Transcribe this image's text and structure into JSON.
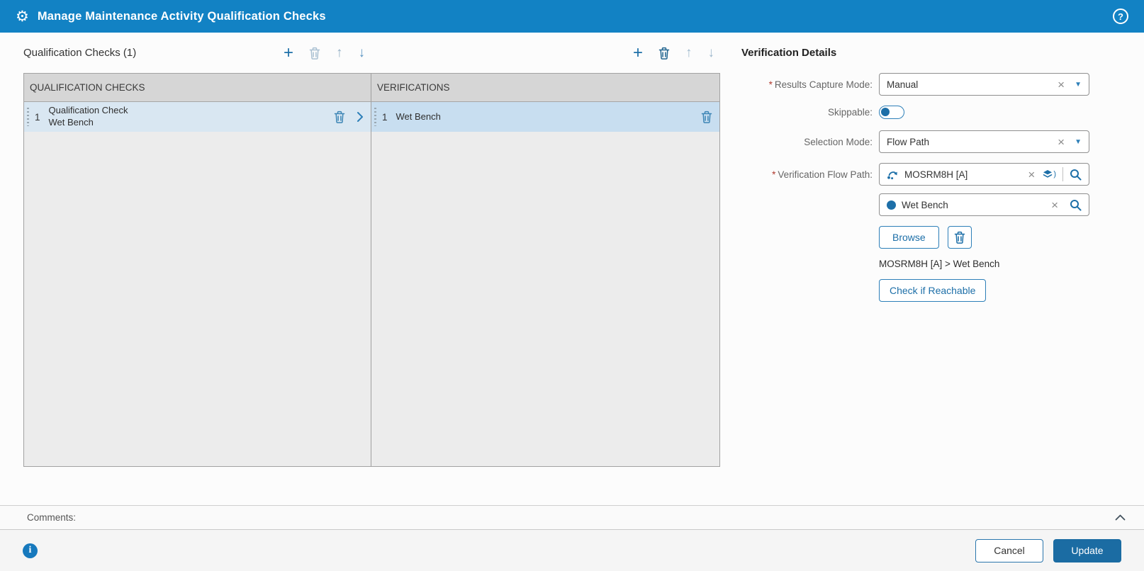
{
  "header": {
    "title": "Manage Maintenance Activity Qualification Checks"
  },
  "icons": {
    "add": "+",
    "move_up": "↑",
    "move_down": "↓",
    "clear": "×",
    "caret_down": "▼",
    "help": "?",
    "info": "i",
    "gear": "⚙"
  },
  "qualification_section": {
    "title": "Qualification Checks (1)"
  },
  "table": {
    "columns": [
      {
        "header": "QUALIFICATION CHECKS"
      },
      {
        "header": "VERIFICATIONS"
      }
    ],
    "qualification_rows": [
      {
        "index": "1",
        "title": "Qualification Check",
        "subtitle": "Wet Bench"
      }
    ],
    "verification_rows": [
      {
        "index": "1",
        "label": "Wet Bench"
      }
    ]
  },
  "details_panel": {
    "title": "Verification Details",
    "required_marker": "*",
    "results_capture_mode": {
      "label": "Results Capture Mode:",
      "value": "Manual"
    },
    "skippable": {
      "label": "Skippable:",
      "state": "off"
    },
    "selection_mode": {
      "label": "Selection Mode:",
      "value": "Flow Path"
    },
    "verification_flow_path": {
      "label": "Verification Flow Path:",
      "value": "MOSRM8H [A]",
      "sub_value": "Wet Bench"
    },
    "browse_button": "Browse",
    "path_text": "MOSRM8H [A] > Wet Bench",
    "check_reachable_button": "Check if Reachable"
  },
  "comments": {
    "label": "Comments:"
  },
  "footer": {
    "cancel_label": "Cancel",
    "update_label": "Update"
  },
  "colors": {
    "header_bg": "#1282c4",
    "accent": "#1d6fa8",
    "update_button_bg": "#1b6ca3",
    "selected_row_left": "#d9e7f2",
    "selected_row_right": "#c8def0",
    "table_header_bg": "#d6d6d6",
    "table_body_bg": "#ececec",
    "required_red": "#b03a2e"
  }
}
